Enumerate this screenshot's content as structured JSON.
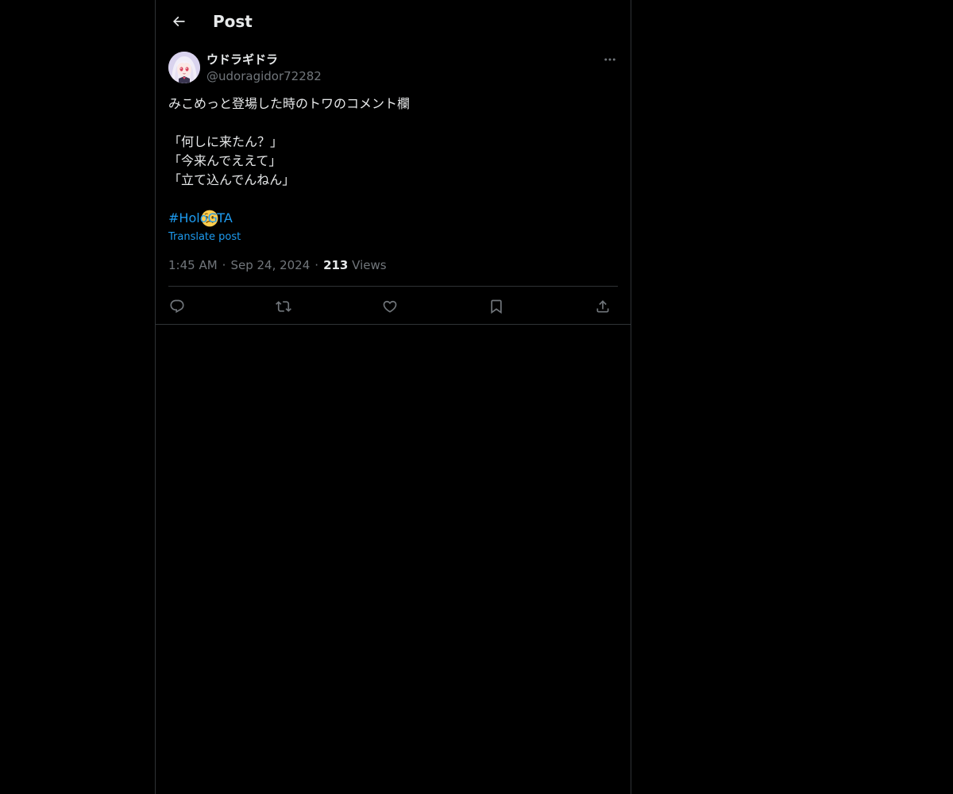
{
  "header": {
    "back_icon": "arrow-left-icon",
    "title": "Post"
  },
  "post": {
    "author": {
      "display_name": "ウドラギドラ",
      "handle": "@udoragidor72282",
      "avatar_icon": "avatar-anime-girl"
    },
    "more_icon": "more-horizontal-icon",
    "text_lines": [
      "みこめっと登場した時のトワのコメント欄",
      "",
      "「何しに来たん？」",
      "「今来んでええて」",
      "「立て込んでんねん」"
    ],
    "emoji": "worried-face-emoji",
    "hashtag": "#HoloGTA",
    "translate_label": "Translate post",
    "time": "1:45 AM",
    "separator": "·",
    "date": "Sep 24, 2024",
    "views_count": "213",
    "views_label": "Views"
  },
  "actions": [
    {
      "name": "reply-icon"
    },
    {
      "name": "repost-icon"
    },
    {
      "name": "like-icon"
    },
    {
      "name": "bookmark-icon"
    },
    {
      "name": "share-icon"
    }
  ],
  "colors": {
    "background": "#000000",
    "text": "#e7e9ea",
    "secondary_text": "#71767b",
    "accent": "#1d9bf0",
    "border": "#2f3336"
  }
}
